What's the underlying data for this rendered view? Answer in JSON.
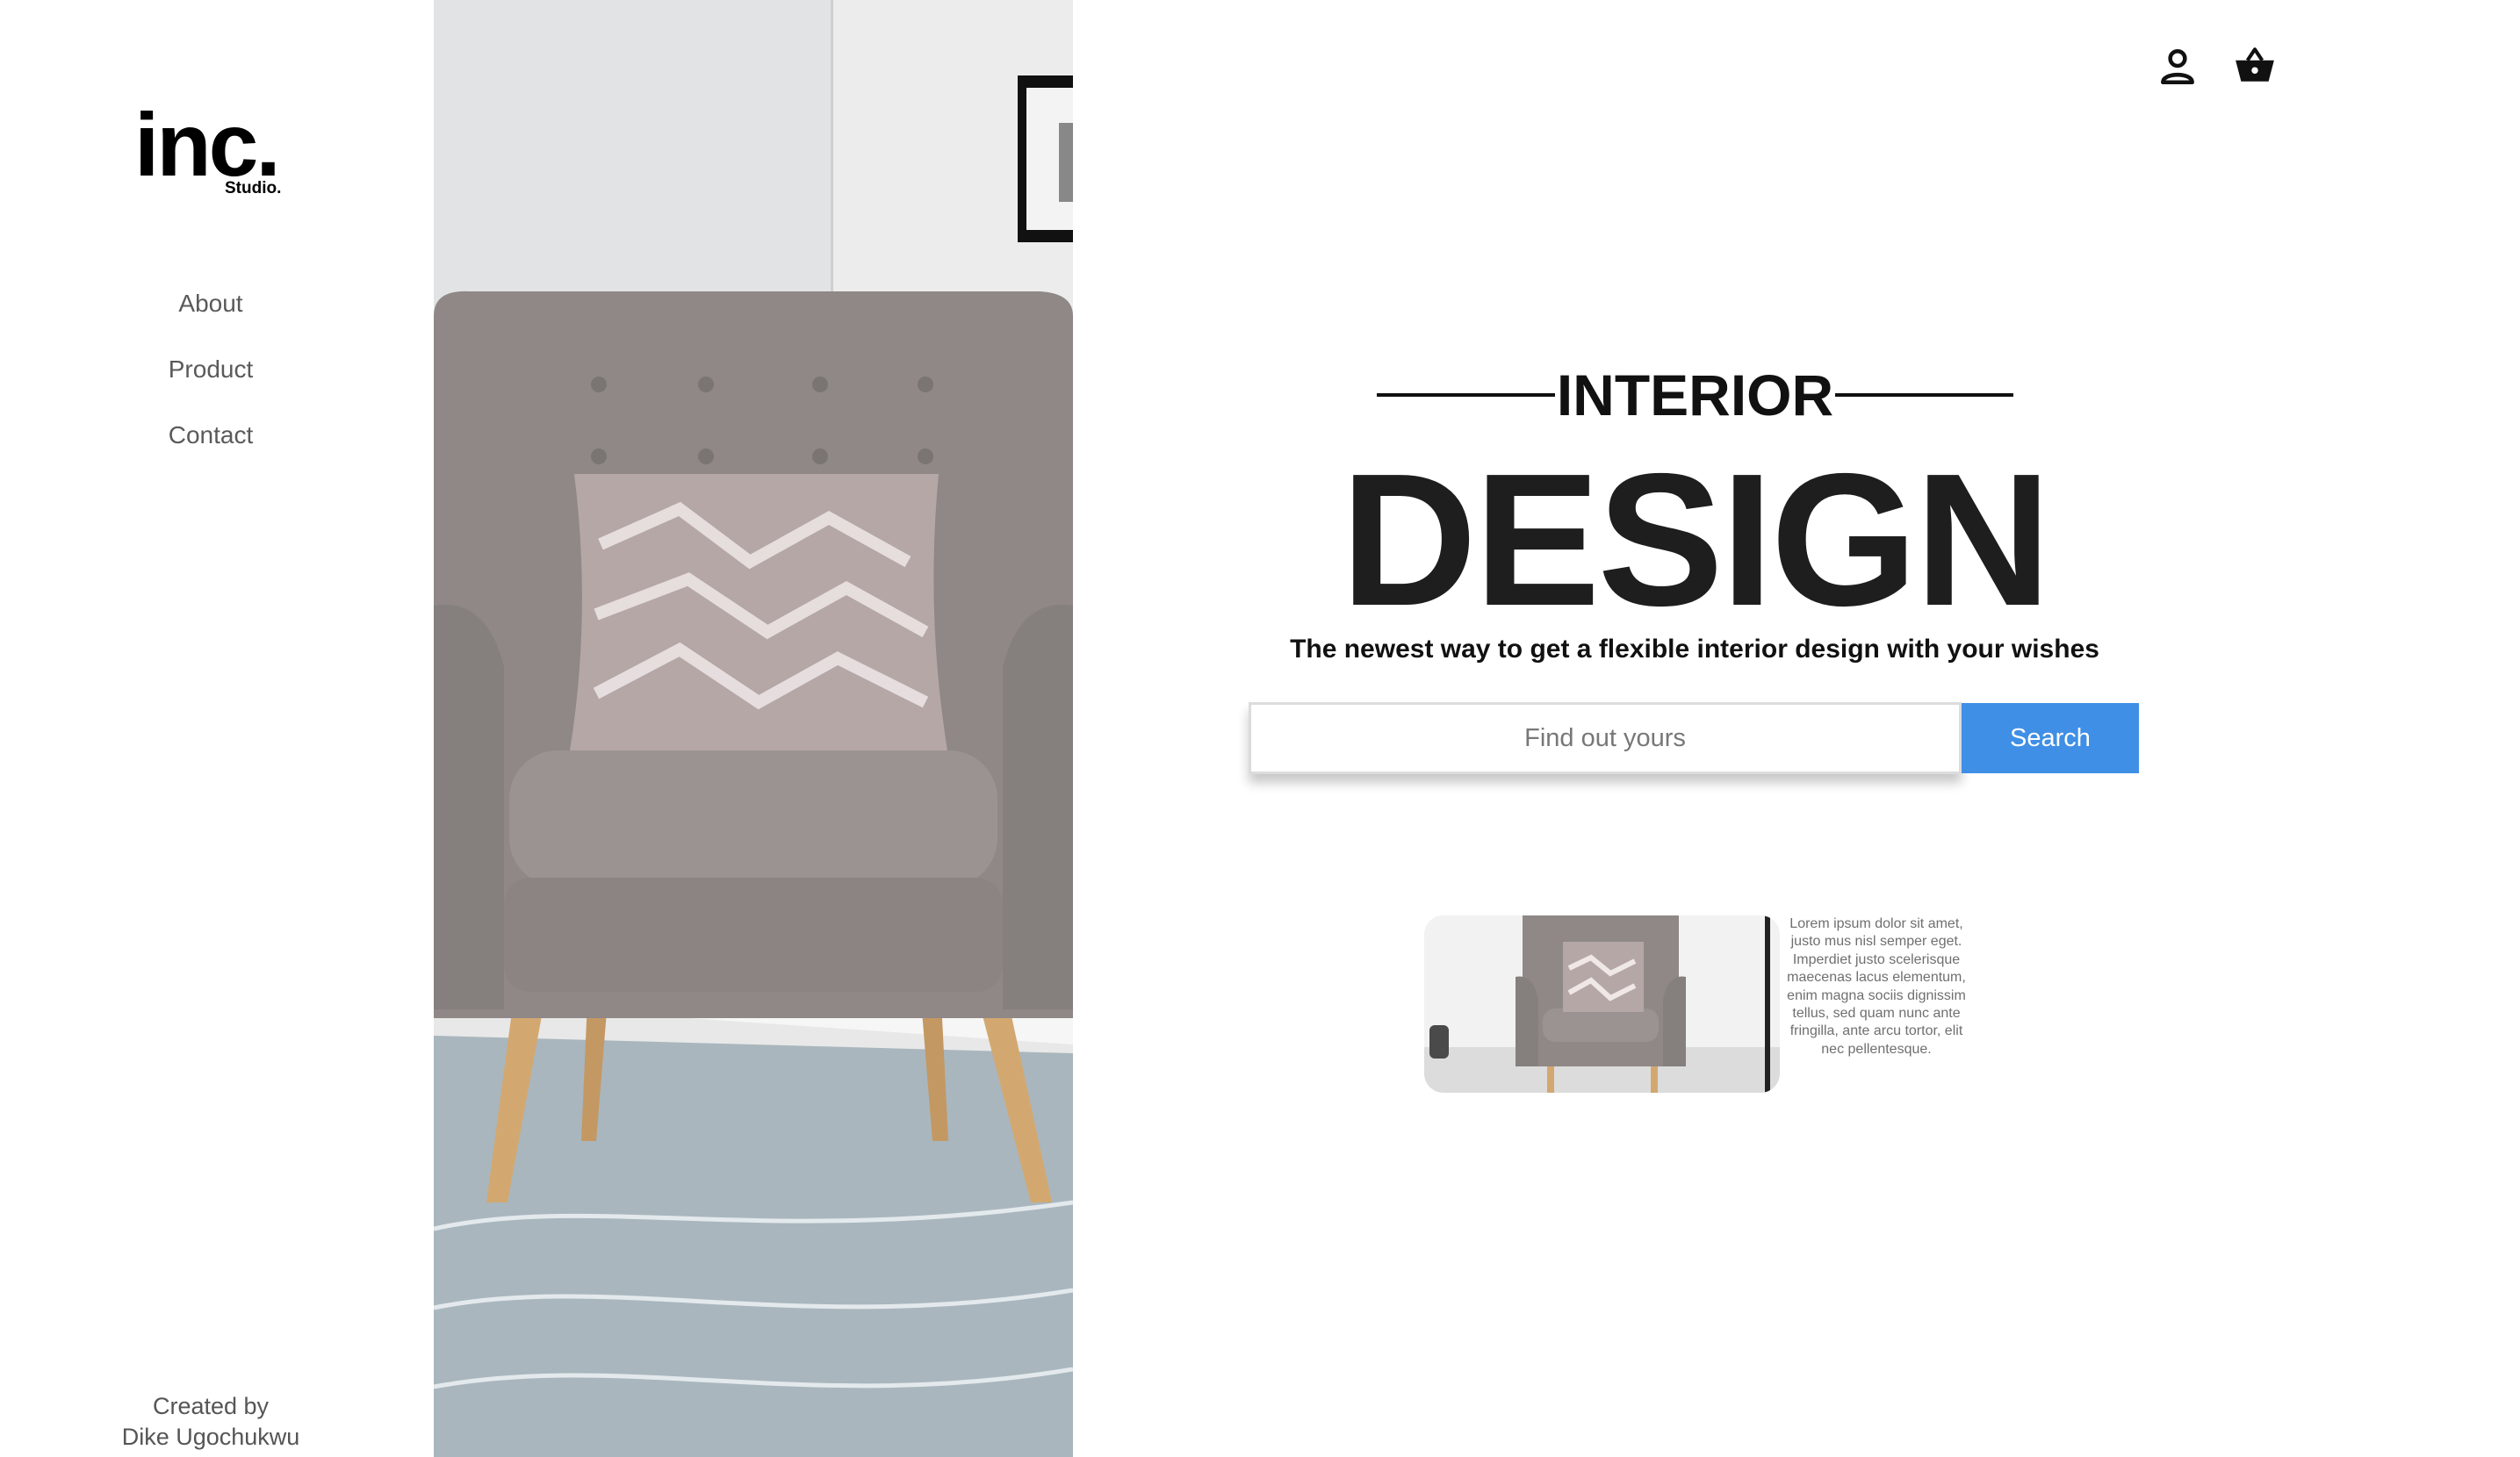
{
  "brand": {
    "logo": "inc.",
    "sub": "Studio."
  },
  "nav": {
    "items": [
      {
        "label": "About"
      },
      {
        "label": "Product"
      },
      {
        "label": "Contact"
      }
    ]
  },
  "footer": {
    "line1": "Created by",
    "line2": "Dike Ugochukwu"
  },
  "header": {
    "icons": [
      "user-icon",
      "basket-icon"
    ]
  },
  "hero": {
    "eyebrow": "INTERIOR",
    "title": "DESIGN",
    "tagline": "The newest way to get a flexible interior design with your wishes",
    "image": "armchair-photo"
  },
  "search": {
    "placeholder": "Find out yours",
    "value": "",
    "button": "Search"
  },
  "card": {
    "image": "armchair-thumbnail",
    "text": "Lorem ipsum dolor sit amet, justo mus nisl semper eget. Imperdiet justo scelerisque maecenas lacus elementum, enim magna sociis dignissim tellus, sed quam nunc ante fringilla, ante arcu tortor, elit nec pellentesque."
  },
  "colors": {
    "accent": "#3f8fe6",
    "text": "#111111",
    "muted": "#5a5a5a"
  }
}
